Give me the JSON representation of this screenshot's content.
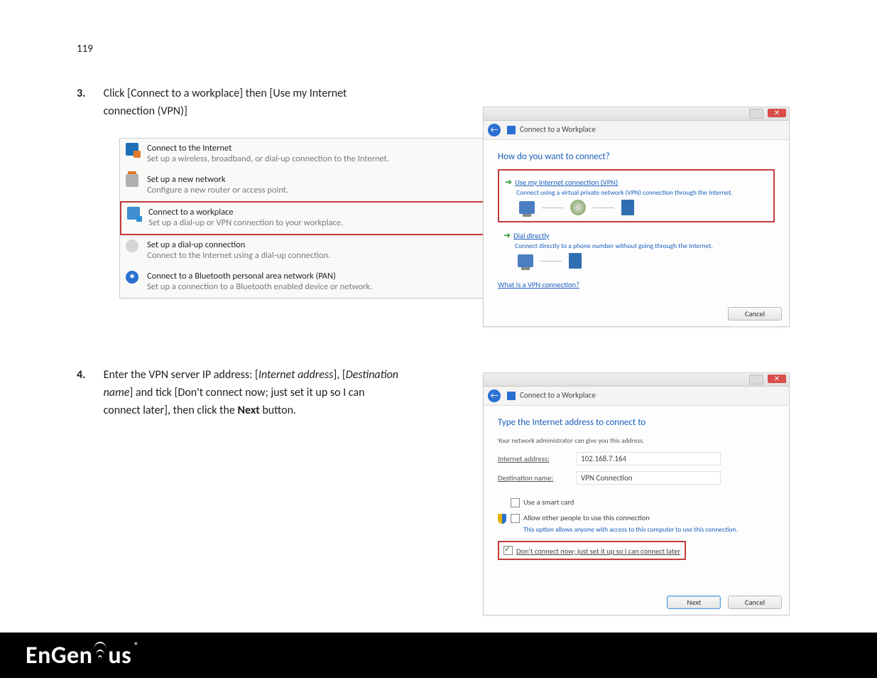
{
  "page_number": "119",
  "step3": {
    "num": "3.",
    "text_a": "Click [Connect to a workplace] then [Use my Internet",
    "text_b": "connection (VPN)]"
  },
  "step4": {
    "num": "4.",
    "text_a_pre": "Enter the VPN server IP address: [",
    "text_a_em1": "Internet address",
    "text_a_mid": "], [",
    "text_a_em2": "Destination",
    "text_b_em": "name",
    "text_b_mid": "] and tick [Don't connect now; just set it up so I can",
    "text_c_pre": "connect later], then click the ",
    "text_c_bold": "Next",
    "text_c_post": " button."
  },
  "shot1": {
    "opts": {
      "o1_t": "Connect to the Internet",
      "o1_s": "Set up a wireless, broadband, or dial-up connection to the Internet.",
      "o2_t": "Set up a new network",
      "o2_s": "Configure a new router or access point.",
      "o3_t": "Connect to a workplace",
      "o3_s": "Set up a dial-up or VPN connection to your workplace.",
      "o4_t": "Set up a dial-up connection",
      "o4_s": "Connect to the Internet using a dial-up connection.",
      "o5_t": "Connect to a Bluetooth personal area network (PAN)",
      "o5_s": "Set up a connection to a Bluetooth enabled device or network."
    }
  },
  "win1": {
    "title": "Connect to a Workplace",
    "q": "How do you want to connect?",
    "opt1_t": "Use my Internet connection (VPN)",
    "opt1_s": "Connect using a virtual private network (VPN) connection through the Internet.",
    "opt2_t": "Dial directly",
    "opt2_s": "Connect directly to a phone number without going through the Internet.",
    "link": "What is a VPN connection?",
    "cancel": "Cancel"
  },
  "win2": {
    "title": "Connect to a Workplace",
    "heading": "Type the Internet address to connect to",
    "sub": "Your network administrator can give you this address.",
    "lbl_addr": "Internet address:",
    "val_addr": "102.168.7.164",
    "lbl_dest": "Destination name:",
    "val_dest": "VPN Connection",
    "chk_smart": "Use a smart card",
    "chk_allow": "Allow other people to use this connection",
    "allow_sub": "This option allows anyone with access to this computer to use this connection.",
    "chk_later": "Don't connect now; just set it up so I can connect later",
    "next": "Next",
    "cancel": "Cancel"
  },
  "brand": {
    "text_a": "EnGen",
    "text_b": "us",
    "reg": "®"
  }
}
